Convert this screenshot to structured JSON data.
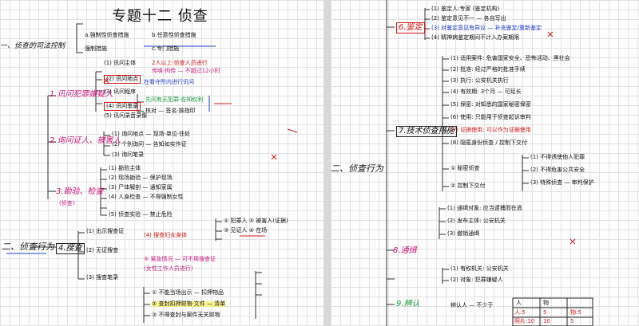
{
  "left": {
    "title": "专题十二 侦查",
    "h1": "一、侦查的司法控制",
    "h1_a": "a.强制性侦查措施",
    "h1_b": "b.任意性侦查措施",
    "h1_c": "强制措施",
    "h1_d": "c.专门措施",
    "s1": "1.讯问犯罪嫌疑人",
    "s1_items": [
      "(1) 讯问主体",
      "(2) 讯问地点",
      "(3) 讯问程序",
      "(4) 讯问笔录",
      "(5) 讯问录音录像"
    ],
    "s1_notes": [
      "2人以上·侦查人员进行",
      "传唤·拘传 — 不超过12小时",
      "在看守所内进行讯问",
      "先问有无犯罪·告知权利",
      "核对 — 签名·捺指印"
    ],
    "s2": "2.询问证人、被害人",
    "s2_items": [
      "(1) 询问地点 — 现场·单位·住处",
      "(2) 个别询问 — 告知如实作证",
      "(3) 询问笔录"
    ],
    "s3": "3.勘验、检查",
    "s3_note": "(侦查)",
    "s3_items": [
      "(1) 勘验主体",
      "(2) 现场勘验 — 保护现场",
      "(3) 尸体解剖 — 通知家属",
      "(4) 人身检查 — 不得强制女性",
      "(5) 侦查实验 — 禁止危险"
    ],
    "h2": "二、侦查行为",
    "s4": "4.搜查",
    "s4_items": [
      "(1) 出示搜查证",
      "(2) 无证搜查",
      "(3) 搜查笔录",
      "(4) 搜查妇女身体"
    ],
    "s4_notes": [
      "① 犯罪人  ② 被害人(证据)",
      "③ 见证人  ④ 在场",
      "⑤ 紧急情况 — 可不用搜查证",
      "(女性工作人员进行)"
    ],
    "bottom_notes": [
      "① 不能当场出示 — 扣押物品",
      "② 查封扣押财物·文件 — 清单",
      "③ 不得查封与案件无关财物"
    ]
  },
  "right": {
    "s6": "6.鉴定",
    "s6_items": [
      "(1) 鉴定人:专家 (鉴定机构)",
      "(2) 鉴定意见不一 — 各自写出",
      "(3) 对鉴定意见有异议 — 补充鉴定/重新鉴定",
      "(4) 精神病鉴定期间不计入办案期限"
    ],
    "s7": "7.技术侦查措施",
    "s7_items": [
      "(1) 适用案件: 危害国家安全、恐怖活动、黑社会",
      "(2) 批准: 经过严格的批准手续",
      "(3) 执行: 公安机关执行",
      "(4) 有效期: 3个月 — 可延长",
      "(5) 保密: 对知悉的国家秘密保密",
      "(6) 使用: 只能用于侦查起诉审判",
      "(7) 证据使用: 可以作为证据使用",
      "(8) 隐匿身份侦查 / 控制下交付"
    ],
    "s7_side": [
      "(1) 不得诱使他人犯罪",
      "(2) 不得危害公共安全",
      "① 秘密侦查",
      "② 控制下交付",
      "(3) 特殊侦查 — 审判保护"
    ],
    "h2": "二、侦查行为",
    "s8": "8.通缉",
    "s8_items": [
      "(1) 通缉对象: 应当逮捕而在逃",
      "(2) 发布主体: 公安机关",
      "(3) 撤销通缉"
    ],
    "s9_items": [
      "(1) 有权机关: 公安机关",
      "(2) 对象: 犯罪嫌疑人"
    ],
    "s9": "9.辨认",
    "table": {
      "headers": [
        "人",
        "物"
      ],
      "rows": [
        [
          "人:5",
          "5"
        ],
        [
          "照片:10",
          "10"
        ],
        [
          "物:5",
          "5"
        ]
      ]
    },
    "bottom_label": "辨认人 — 不少于"
  }
}
